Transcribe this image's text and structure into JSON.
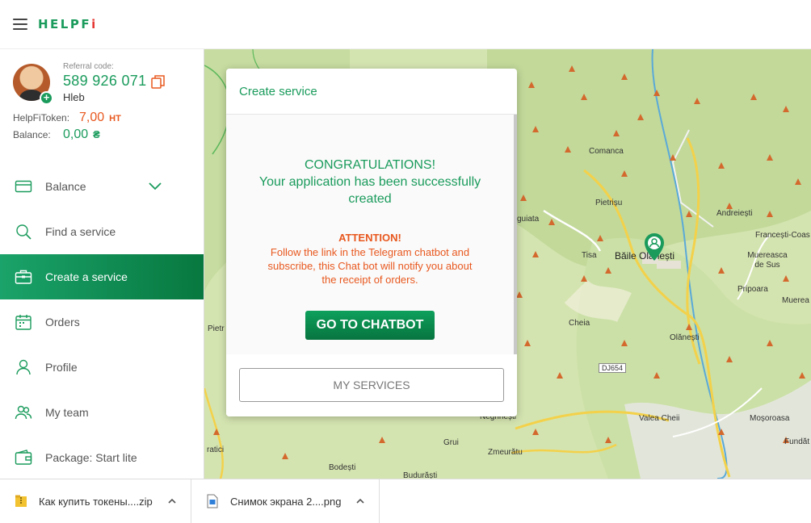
{
  "header": {
    "logo_a": "HELPF",
    "logo_b": "i"
  },
  "profile": {
    "referral_label": "Referral code:",
    "referral_code": "589 926 071",
    "name": "Hleb",
    "token_label": "HelpFiToken:",
    "token_value": "7,00",
    "token_unit": "HT",
    "balance_label": "Balance:",
    "balance_value": "0,00",
    "balance_unit": "₴"
  },
  "menu": [
    {
      "label": "Balance",
      "icon": "credit-card-icon"
    },
    {
      "label": "Find a service",
      "icon": "search-icon"
    },
    {
      "label": "Create a service",
      "icon": "briefcase-icon"
    },
    {
      "label": "Orders",
      "icon": "calendar-icon"
    },
    {
      "label": "Profile",
      "icon": "user-icon"
    },
    {
      "label": "My team",
      "icon": "team-icon"
    },
    {
      "label": "Package: Start lite",
      "icon": "wallet-icon"
    }
  ],
  "modal": {
    "title": "Create service",
    "congrats": [
      "CONGRATULATIONS!",
      "Your application has been successfully",
      "created"
    ],
    "attention_title": "ATTENTION!",
    "attention_text": [
      "Follow the link in the Telegram chatbot and",
      "subscribe, this Chat bot will notify you about",
      "the receipt of orders."
    ],
    "chatbot_button": "GO TO CHATBOT",
    "my_services_button": "MY SERVICES"
  },
  "map": {
    "labels": [
      "Comanca",
      "Pietrișu",
      "guiata",
      "Tisa",
      "Băile Olănești",
      "Andreiești",
      "Francești-Coas",
      "Muereasca de Sus",
      "Pripoara",
      "Muerea",
      "Cheia",
      "Olănești",
      "DJ654",
      "Pietr",
      "Valea Cheii",
      "Moșoroasa",
      "Negrinești",
      "Grui",
      "Zmeurătu",
      "Bodești",
      "Budurăști",
      "ratici",
      "Fundăt"
    ]
  },
  "downloads": [
    {
      "name": "Как купить токены....zip",
      "icon": "zip-file-icon"
    },
    {
      "name": "Снимок экрана 2....png",
      "icon": "image-file-icon"
    }
  ]
}
